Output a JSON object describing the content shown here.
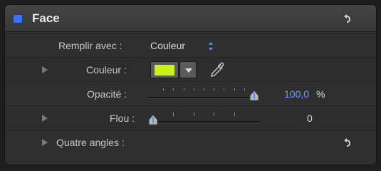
{
  "header": {
    "title": "Face",
    "enabled": true,
    "checkbox_color": "#3b73f5",
    "reset_icon": "reset-arrow-icon"
  },
  "rows": {
    "fill_with": {
      "label": "Remplir avec :",
      "value": "Couleur",
      "icon": "popup-arrows-icon"
    },
    "color": {
      "label": "Couleur :",
      "swatch_color": "#c9f21b",
      "icon": "eyedropper-icon"
    },
    "opacity": {
      "label": "Opacité :",
      "value": "100,0",
      "unit": "%",
      "level": 100
    },
    "blur": {
      "label": "Flou :",
      "value": "0",
      "level": 0
    },
    "four_corners": {
      "label": "Quatre angles :",
      "reset_icon": "reset-arrow-icon"
    }
  },
  "accent_color": "#4a8cff"
}
